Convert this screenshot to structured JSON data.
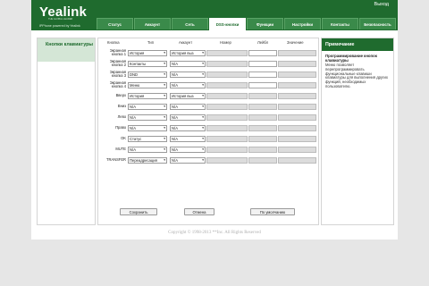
{
  "header": {
    "logo": "Yealink",
    "logo_sub": "THE GLOBAL LEADER",
    "tagline": "IPPhone powered by Yealink",
    "logout": "Выход",
    "tabs": [
      "Статус",
      "Аккаунт",
      "Сеть",
      "DSS-кнопки",
      "Функции",
      "Настройки",
      "Контакты",
      "Безопасность"
    ],
    "active_tab": "DSS-кнопки"
  },
  "sidebar": {
    "items": [
      {
        "label": "Кнопки клавиатуры"
      }
    ]
  },
  "table": {
    "headers": {
      "key": "Кнопка",
      "type": "Тип",
      "account": "Аккаунт",
      "number": "Номер",
      "label": "Лейбл",
      "value": "Значение"
    },
    "rows": [
      {
        "label": "Экранная кнопка 1",
        "type": "История",
        "account": "История выз",
        "number_enabled": false,
        "label_enabled": true,
        "value_enabled": false
      },
      {
        "label": "Экранная кнопка 2",
        "type": "Контакты",
        "account": "N/A",
        "number_enabled": false,
        "label_enabled": true,
        "value_enabled": false
      },
      {
        "label": "Экранная кнопка 3",
        "type": "DND",
        "account": "N/A",
        "number_enabled": false,
        "label_enabled": true,
        "value_enabled": false
      },
      {
        "label": "Экранная кнопка 4",
        "type": "Меню",
        "account": "N/A",
        "number_enabled": false,
        "label_enabled": true,
        "value_enabled": false
      },
      {
        "label": "Вверх",
        "type": "История",
        "account": "История выз",
        "number_enabled": false,
        "label_enabled": false,
        "value_enabled": false
      },
      {
        "label": "Вниз",
        "type": "N/A",
        "account": "N/A",
        "number_enabled": false,
        "label_enabled": false,
        "value_enabled": false
      },
      {
        "label": "Лево",
        "type": "N/A",
        "account": "N/A",
        "number_enabled": false,
        "label_enabled": false,
        "value_enabled": false
      },
      {
        "label": "Право",
        "type": "N/A",
        "account": "N/A",
        "number_enabled": false,
        "label_enabled": false,
        "value_enabled": false
      },
      {
        "label": "OK",
        "type": "Статус",
        "account": "N/A",
        "number_enabled": false,
        "label_enabled": false,
        "value_enabled": false
      },
      {
        "label": "MUTE",
        "type": "N/A",
        "account": "N/A",
        "number_enabled": false,
        "label_enabled": false,
        "value_enabled": false
      },
      {
        "label": "TRANSFER",
        "type": "Переадресация",
        "account": "N/A",
        "number_enabled": false,
        "label_enabled": false,
        "value_enabled": false
      }
    ]
  },
  "buttons": {
    "save": "Сохранить",
    "cancel": "Отмена",
    "default": "По умолчанию"
  },
  "note": {
    "header": "Примечание",
    "title": "Программирование кнопок клавиатуры",
    "body": "Меню позволяет перепрограммировать функциональные клавиши клавиатуры для выполнения других функций, необходимых пользователю."
  },
  "footer": {
    "copyright": "Copyright © 1998-2013 **Inc. All Rights Reserved"
  },
  "colors": {
    "brand": "#1f6b2e",
    "sidebar_active_bg": "#d4e6d6",
    "page_bg": "#e6e6e6"
  },
  "icons": {
    "dropdown": "chevron-down-icon"
  }
}
